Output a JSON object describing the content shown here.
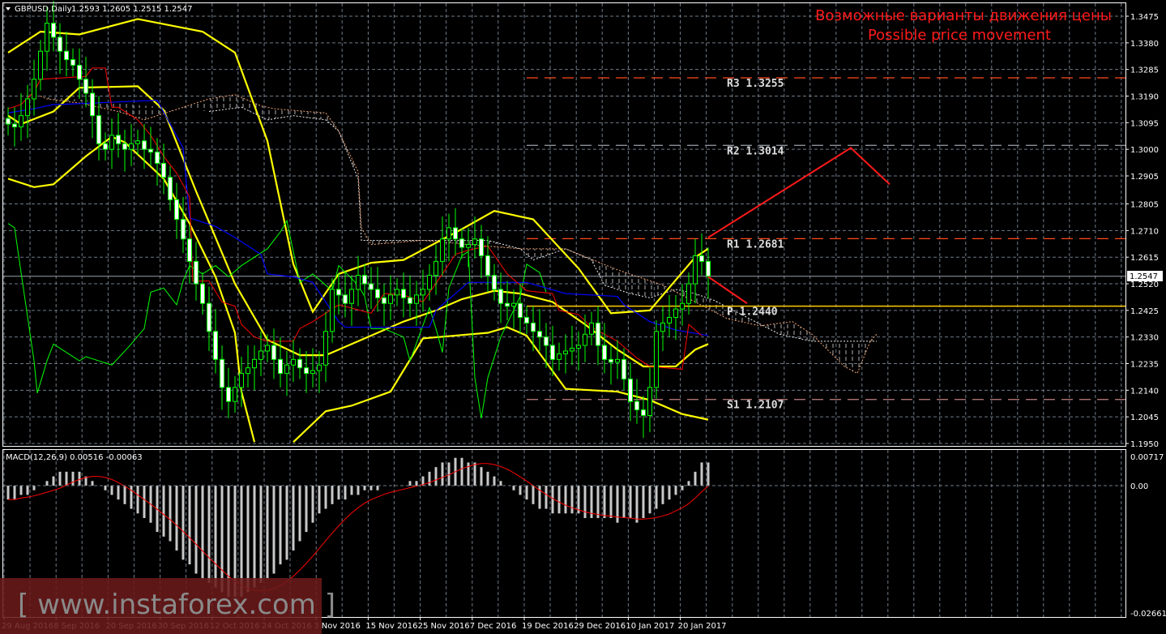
{
  "header": {
    "symbol_label": "GBPUSD,Daily",
    "ohlc_text": "1.2593 1.2605 1.2515 1.2547",
    "macd_label": "MACD(12,26,9) 0.00516 -0.00063"
  },
  "annotation": {
    "line1": "Возможные варианты движения цены",
    "line2": "Possible price movement"
  },
  "watermark": "[ www.instaforex.com ]",
  "current_price": "1.2547",
  "colors": {
    "bull_outline": "#00ff00",
    "bear_fill": "#ffffff",
    "bands": "#ffff00",
    "tenkan": "#ff0000",
    "kijun": "#0000ff",
    "chikou": "#00ff00",
    "forecast": "#ff1a1a",
    "pivot_p": "#ffcc00",
    "resist": "#ff4a1a",
    "support": "#c08080"
  },
  "chart_data": [
    {
      "type": "candlestick",
      "title": "GBPUSD,Daily",
      "ylim": [
        1.195,
        1.3475
      ],
      "y_ticks": [
        "1.3475",
        "1.3380",
        "1.3285",
        "1.3190",
        "1.3095",
        "1.3000",
        "1.2905",
        "1.2805",
        "1.2710",
        "1.2615",
        "1.2520",
        "1.2425",
        "1.2330",
        "1.2235",
        "1.2140",
        "1.2045",
        "1.1950"
      ],
      "x_ticks": [
        "29 Aug 2016",
        "8 Sep 2016",
        "20 Sep 2016",
        "30 Sep 2016",
        "12 Oct 2016",
        "24 Oct 2016",
        "3 Nov 2016",
        "15 Nov 2016",
        "25 Nov 2016",
        "7 Dec 2016",
        "19 Dec 2016",
        "29 Dec 2016",
        "10 Jan 2017",
        "20 Jan 2017"
      ],
      "close": [
        1.309,
        1.308,
        1.312,
        1.318,
        1.325,
        1.335,
        1.345,
        1.34,
        1.335,
        1.332,
        1.33,
        1.325,
        1.32,
        1.312,
        1.302,
        1.3,
        1.305,
        1.302,
        1.3,
        1.302,
        1.303,
        1.3,
        1.299,
        1.295,
        1.29,
        1.282,
        1.275,
        1.268,
        1.26,
        1.252,
        1.245,
        1.235,
        1.225,
        1.215,
        1.21,
        1.215,
        1.22,
        1.222,
        1.225,
        1.228,
        1.23,
        1.225,
        1.22,
        1.223,
        1.225,
        1.222,
        1.22,
        1.221,
        1.223,
        1.235,
        1.25,
        1.248,
        1.245,
        1.25,
        1.255,
        1.252,
        1.25,
        1.247,
        1.245,
        1.248,
        1.25,
        1.247,
        1.245,
        1.248,
        1.25,
        1.255,
        1.26,
        1.268,
        1.272,
        1.268,
        1.265,
        1.266,
        1.268,
        1.262,
        1.255,
        1.25,
        1.245,
        1.244,
        1.245,
        1.24,
        1.238,
        1.235,
        1.233,
        1.23,
        1.225,
        1.227,
        1.228,
        1.229,
        1.23,
        1.234,
        1.238,
        1.23,
        1.225,
        1.224,
        1.225,
        1.218,
        1.21,
        1.207,
        1.205,
        1.215,
        1.235,
        1.238,
        1.24,
        1.243,
        1.245,
        1.252,
        1.262,
        1.26,
        1.2547
      ],
      "pivots": [
        {
          "name": "R3",
          "label": "R3  1.3255",
          "value": 1.3255,
          "style": "resist"
        },
        {
          "name": "R2",
          "label": "R2  1.3014",
          "value": 1.3014,
          "style": "r2"
        },
        {
          "name": "R1",
          "label": "R1  1.2681",
          "value": 1.2681,
          "style": "resist"
        },
        {
          "name": "P",
          "label": "P  1.2440",
          "value": 1.244,
          "style": "pivot"
        },
        {
          "name": "S1",
          "label": "S1  1.2107",
          "value": 1.2107,
          "style": "support"
        }
      ],
      "forecast_paths": [
        [
          [
            108,
            1.2685
          ],
          [
            130,
            1.3005
          ],
          [
            136,
            1.2875
          ]
        ],
        [
          [
            108,
            1.2545
          ],
          [
            114,
            1.245
          ]
        ]
      ],
      "bands": [
        [
          [
            0,
            1.3345
          ],
          [
            5,
            1.342
          ],
          [
            11,
            1.341
          ],
          [
            20,
            1.3465
          ],
          [
            30,
            1.342
          ],
          [
            35,
            1.3345
          ],
          [
            40,
            1.303
          ],
          [
            44,
            1.259
          ],
          [
            47,
            1.242
          ],
          [
            51,
            1.2555
          ],
          [
            56,
            1.2595
          ],
          [
            61,
            1.2605
          ],
          [
            70,
            1.2715
          ],
          [
            75,
            1.278
          ],
          [
            81,
            1.275
          ],
          [
            88,
            1.2575
          ],
          [
            93,
            1.2415
          ],
          [
            99,
            1.2425
          ],
          [
            106,
            1.2615
          ],
          [
            108,
            1.2645
          ]
        ],
        [
          [
            0,
            1.312
          ],
          [
            2,
            1.309
          ],
          [
            7,
            1.3135
          ],
          [
            11,
            1.322
          ],
          [
            20,
            1.3225
          ],
          [
            24,
            1.314
          ],
          [
            29,
            1.285
          ],
          [
            35,
            1.252
          ],
          [
            40,
            1.232
          ],
          [
            45,
            1.2265
          ],
          [
            49,
            1.2265
          ],
          [
            54,
            1.2315
          ],
          [
            61,
            1.2385
          ],
          [
            66,
            1.2425
          ],
          [
            70,
            1.2465
          ],
          [
            75,
            1.2495
          ],
          [
            79,
            1.2485
          ],
          [
            84,
            1.2455
          ],
          [
            89,
            1.2375
          ],
          [
            94,
            1.2285
          ],
          [
            98,
            1.2225
          ],
          [
            103,
            1.2225
          ],
          [
            106,
            1.2285
          ],
          [
            108,
            1.2305
          ]
        ],
        [
          [
            0,
            1.2895
          ],
          [
            4,
            1.2865
          ],
          [
            7,
            1.2875
          ],
          [
            12,
            1.2975
          ],
          [
            16,
            1.3045
          ],
          [
            18,
            1.3025
          ],
          [
            24,
            1.2895
          ],
          [
            28,
            1.2735
          ],
          [
            32,
            1.2545
          ],
          [
            35,
            1.2345
          ],
          [
            36,
            1.2135
          ],
          [
            38,
            1.1955
          ]
        ],
        [
          [
            44,
            1.1955
          ],
          [
            49,
            1.2065
          ],
          [
            53,
            1.2085
          ],
          [
            59,
            1.2135
          ],
          [
            64,
            1.2325
          ],
          [
            69,
            1.2335
          ],
          [
            74,
            1.2345
          ],
          [
            77,
            1.2365
          ],
          [
            80,
            1.2335
          ],
          [
            86,
            1.2145
          ],
          [
            94,
            1.2135
          ],
          [
            99,
            1.2105
          ],
          [
            104,
            1.2055
          ],
          [
            108,
            1.2035
          ]
        ]
      ],
      "tenkan": [
        [
          0,
          1.3145
        ],
        [
          2,
          1.316
        ],
        [
          4,
          1.3205
        ],
        [
          5,
          1.325
        ],
        [
          12,
          1.326
        ],
        [
          13,
          1.329
        ],
        [
          15,
          1.329
        ],
        [
          16,
          1.315
        ],
        [
          17,
          1.315
        ],
        [
          20,
          1.3105
        ],
        [
          22,
          1.305
        ],
        [
          24,
          1.2975
        ],
        [
          26,
          1.2915
        ],
        [
          28,
          1.283
        ],
        [
          28.5,
          1.253
        ],
        [
          31,
          1.253
        ],
        [
          33,
          1.2455
        ],
        [
          35,
          1.244
        ],
        [
          36,
          1.2375
        ],
        [
          38,
          1.233
        ],
        [
          40,
          1.2315
        ],
        [
          44,
          1.2315
        ],
        [
          45,
          1.236
        ],
        [
          47,
          1.2385
        ],
        [
          51,
          1.2445
        ],
        [
          56,
          1.2415
        ],
        [
          58,
          1.2485
        ],
        [
          61,
          1.248
        ],
        [
          64,
          1.2455
        ],
        [
          67,
          1.2555
        ],
        [
          69,
          1.2625
        ],
        [
          71,
          1.264
        ],
        [
          74,
          1.2655
        ],
        [
          77,
          1.2555
        ],
        [
          80,
          1.2495
        ],
        [
          84,
          1.2485
        ],
        [
          85,
          1.2425
        ],
        [
          88,
          1.241
        ],
        [
          90,
          1.2365
        ],
        [
          94,
          1.2315
        ],
        [
          97,
          1.2255
        ],
        [
          99,
          1.2225
        ],
        [
          104,
          1.2215
        ],
        [
          105,
          1.2375
        ],
        [
          107,
          1.2335
        ]
      ],
      "kijun": [
        [
          0,
          1.313
        ],
        [
          4,
          1.3145
        ],
        [
          7,
          1.316
        ],
        [
          8,
          1.316
        ],
        [
          23,
          1.3175
        ],
        [
          27,
          1.3005
        ],
        [
          28,
          1.2755
        ],
        [
          32,
          1.2725
        ],
        [
          35,
          1.2685
        ],
        [
          39,
          1.2625
        ],
        [
          40,
          1.2555
        ],
        [
          44,
          1.2545
        ],
        [
          47,
          1.2525
        ],
        [
          51,
          1.2385
        ],
        [
          52,
          1.2365
        ],
        [
          65,
          1.2365
        ],
        [
          66,
          1.2425
        ],
        [
          71,
          1.2525
        ],
        [
          80,
          1.2525
        ],
        [
          86,
          1.2485
        ],
        [
          94,
          1.2475
        ],
        [
          95,
          1.2445
        ],
        [
          99,
          1.2385
        ],
        [
          103,
          1.2355
        ],
        [
          108,
          1.2335
        ]
      ],
      "chikou": [
        [
          0,
          1.2735
        ],
        [
          1,
          1.272
        ],
        [
          2,
          1.256
        ],
        [
          4,
          1.2245
        ],
        [
          4.5,
          1.213
        ],
        [
          6,
          1.2245
        ],
        [
          7,
          1.2305
        ],
        [
          9,
          1.2275
        ],
        [
          11,
          1.2245
        ],
        [
          12,
          1.226
        ],
        [
          14,
          1.2245
        ],
        [
          16,
          1.223
        ],
        [
          19,
          1.2305
        ],
        [
          21,
          1.236
        ],
        [
          22,
          1.249
        ],
        [
          24,
          1.2505
        ],
        [
          26,
          1.2445
        ],
        [
          27,
          1.253
        ],
        [
          28,
          1.2585
        ],
        [
          30,
          1.2555
        ],
        [
          32,
          1.2585
        ],
        [
          34,
          1.2545
        ],
        [
          36,
          1.2585
        ],
        [
          40,
          1.2645
        ],
        [
          42,
          1.2705
        ],
        [
          43,
          1.2745
        ],
        [
          45,
          1.2525
        ],
        [
          47,
          1.2555
        ],
        [
          50,
          1.2495
        ],
        [
          51,
          1.2585
        ],
        [
          54,
          1.2515
        ],
        [
          55,
          1.2475
        ],
        [
          56,
          1.236
        ],
        [
          58,
          1.236
        ],
        [
          61,
          1.233
        ],
        [
          62,
          1.2245
        ],
        [
          65,
          1.2435
        ],
        [
          66,
          1.236
        ],
        [
          67,
          1.2275
        ],
        [
          68,
          1.2505
        ],
        [
          70,
          1.262
        ],
        [
          71,
          1.2635
        ],
        [
          72,
          1.2185
        ],
        [
          73,
          1.204
        ],
        [
          74,
          1.2185
        ],
        [
          76,
          1.233
        ],
        [
          79,
          1.2475
        ],
        [
          80,
          1.259
        ],
        [
          82,
          1.256
        ],
        [
          83,
          1.249
        ]
      ],
      "cloud_span_a": [
        [
          31,
          1.3135
        ],
        [
          36,
          1.315
        ],
        [
          40,
          1.3105
        ],
        [
          44,
          1.312
        ],
        [
          49,
          1.3105
        ],
        [
          51,
          1.3065
        ],
        [
          54,
          1.2895
        ],
        [
          54.5,
          1.2675
        ],
        [
          64,
          1.2675
        ],
        [
          74,
          1.2675
        ],
        [
          79,
          1.2645
        ],
        [
          81,
          1.2605
        ],
        [
          86,
          1.2645
        ],
        [
          90,
          1.2605
        ],
        [
          92,
          1.2515
        ],
        [
          96,
          1.2485
        ],
        [
          99,
          1.247
        ],
        [
          103,
          1.25
        ],
        [
          106,
          1.2485
        ],
        [
          109,
          1.246
        ],
        [
          114,
          1.24
        ],
        [
          119,
          1.234
        ],
        [
          124,
          1.2315
        ],
        [
          131,
          1.2315
        ],
        [
          134,
          1.2315
        ]
      ],
      "cloud_span_b": [
        [
          5,
          1.319
        ],
        [
          6,
          1.318
        ],
        [
          11,
          1.3165
        ],
        [
          17,
          1.3135
        ],
        [
          21,
          1.3105
        ],
        [
          25,
          1.3135
        ],
        [
          29,
          1.3165
        ],
        [
          31,
          1.318
        ],
        [
          35,
          1.3195
        ],
        [
          39,
          1.3155
        ],
        [
          41,
          1.3145
        ],
        [
          46,
          1.3135
        ],
        [
          49,
          1.313
        ],
        [
          51,
          1.3065
        ],
        [
          54,
          1.292
        ],
        [
          54.5,
          1.272
        ],
        [
          56,
          1.266
        ],
        [
          64,
          1.2675
        ],
        [
          71,
          1.266
        ],
        [
          79,
          1.2645
        ],
        [
          86,
          1.2645
        ],
        [
          94,
          1.257
        ],
        [
          101,
          1.2515
        ],
        [
          106,
          1.2455
        ],
        [
          111,
          1.2395
        ],
        [
          116,
          1.237
        ],
        [
          121,
          1.2385
        ],
        [
          124,
          1.234
        ],
        [
          129,
          1.2225
        ],
        [
          131,
          1.22
        ],
        [
          133,
          1.2315
        ],
        [
          134,
          1.234
        ]
      ]
    },
    {
      "type": "bar",
      "title": "MACD(12,26,9) 0.00516 -0.00063",
      "ylim": [
        -0.02661,
        0.00717
      ],
      "y_ticks": [
        "0.00717",
        "0.00",
        "-0.02661"
      ],
      "histogram_milli": [
        -3,
        -3,
        -2,
        -2,
        -1,
        0,
        1,
        2,
        3,
        3,
        3,
        3,
        2,
        1,
        0,
        -1,
        -2,
        -3,
        -4,
        -5,
        -6,
        -7,
        -8,
        -10,
        -11,
        -12,
        -14,
        -16,
        -17,
        -19,
        -20,
        -21,
        -22,
        -23,
        -24,
        -24,
        -24,
        -23,
        -22,
        -21,
        -20,
        -19,
        -17,
        -16,
        -14,
        -12,
        -10,
        -8,
        -6,
        -5,
        -4,
        -3,
        -3,
        -2,
        -2,
        -1,
        -1,
        -1,
        0,
        0,
        0,
        0,
        1,
        1,
        2,
        3,
        4,
        5,
        5,
        6,
        6,
        5,
        5,
        4,
        3,
        2,
        1,
        0,
        -1,
        -2,
        -3,
        -4,
        -5,
        -5,
        -6,
        -6,
        -6,
        -6,
        -6,
        -7,
        -7,
        -7,
        -7,
        -7,
        -8,
        -7,
        -7,
        -8,
        -7,
        -6,
        -5,
        -4,
        -3,
        -2,
        -1,
        1,
        3,
        5,
        5
      ]
    }
  ]
}
